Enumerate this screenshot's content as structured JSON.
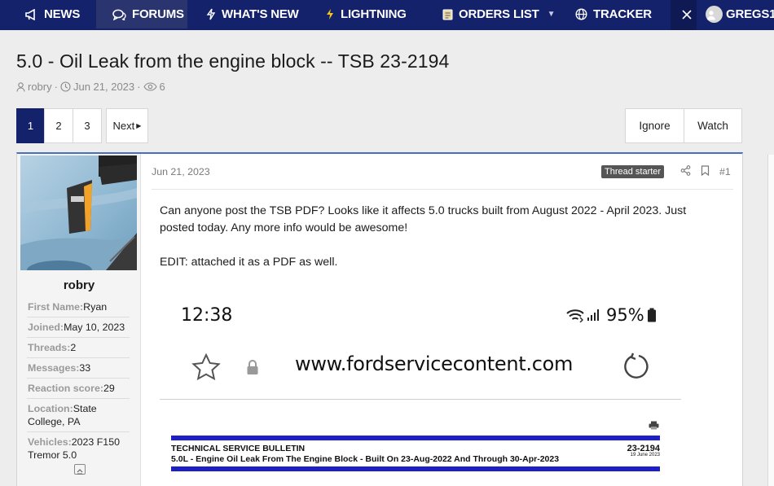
{
  "nav": {
    "items": [
      {
        "label": "NEWS",
        "icon": "megaphone-icon"
      },
      {
        "label": "FORUMS",
        "icon": "chat-bubbles-icon"
      },
      {
        "label": "WHAT'S NEW",
        "icon": "lightning-icon"
      },
      {
        "label": "LIGHTNING",
        "icon": "bolt-icon"
      },
      {
        "label": "ORDERS LIST",
        "icon": "clipboard-icon"
      },
      {
        "label": "TRACKER",
        "icon": "globe-icon"
      }
    ],
    "user": "GREGS1"
  },
  "thread": {
    "title": "5.0 - Oil Leak from the engine block -- TSB 23-2194",
    "author": "robry",
    "date": "Jun 21, 2023",
    "replies": "6"
  },
  "pagination": {
    "pages": [
      "1",
      "2",
      "3"
    ],
    "next": "Next"
  },
  "actions": {
    "ignore": "Ignore",
    "watch": "Watch"
  },
  "post": {
    "date": "Jun 21, 2023",
    "badge": "Thread starter",
    "number": "#1",
    "body1": "Can anyone post the TSB PDF? Looks like it affects 5.0 trucks built from August 2022 - April 2023. Just posted today. Any more info would be awesome!",
    "body2": "EDIT: attached it as a PDF as well."
  },
  "user": {
    "name": "robry",
    "facts": [
      {
        "label": "First Name:",
        "value": "Ryan"
      },
      {
        "label": "Joined:",
        "value": "May 10, 2023"
      },
      {
        "label": "Threads:",
        "value": "2"
      },
      {
        "label": "Messages:",
        "value": "33"
      },
      {
        "label": "Reaction score:",
        "value": "29"
      },
      {
        "label": "Location:",
        "value": "State College, PA"
      },
      {
        "label": "Vehicles:",
        "value": "2023 F150 Tremor 5.0"
      }
    ]
  },
  "attachment": {
    "time": "12:38",
    "battery": "95%",
    "url": "www.fordservicecontent.com",
    "tsb_heading": "TECHNICAL SERVICE BULLETIN",
    "tsb_number": "23-2194",
    "tsb_subject": "5.0L - Engine Oil Leak From The Engine Block - Built On 23-Aug-2022 And Through 30-Apr-2023",
    "tsb_date": "19 June 2023"
  },
  "colors": {
    "nav_bg": "#14216b",
    "accent": "#4a6fbf",
    "tsb_bar": "#1f1fc8"
  }
}
